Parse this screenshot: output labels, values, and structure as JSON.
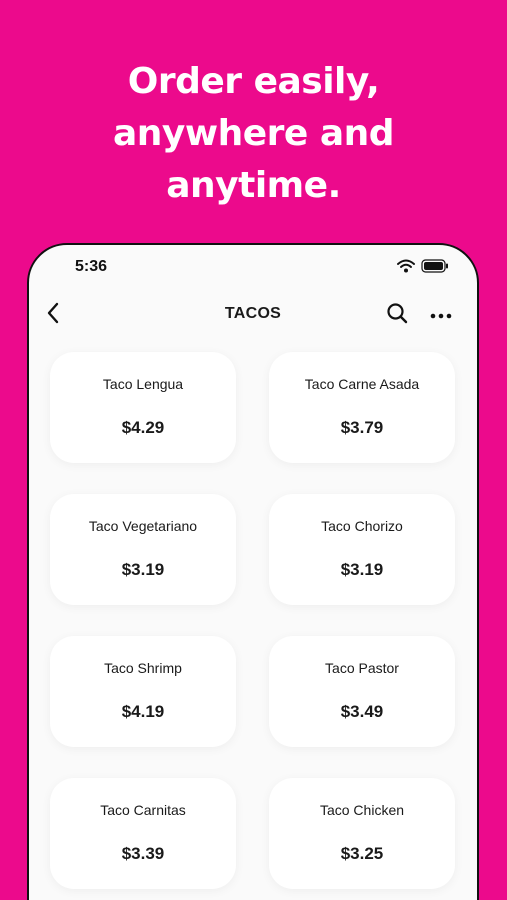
{
  "promo": {
    "line1": "Order easily,",
    "line2": "anywhere and",
    "line3": "anytime."
  },
  "status_bar": {
    "time": "5:36",
    "icons": [
      "wifi-icon",
      "battery-icon"
    ]
  },
  "header": {
    "title": "TACOS",
    "icons": [
      "back-chevron-icon",
      "search-icon",
      "more-icon"
    ]
  },
  "menu_items": [
    {
      "name": "Taco Lengua",
      "price": "$4.29"
    },
    {
      "name": "Taco Carne Asada",
      "price": "$3.79"
    },
    {
      "name": "Taco Vegetariano",
      "price": "$3.19"
    },
    {
      "name": "Taco Chorizo",
      "price": "$3.19"
    },
    {
      "name": "Taco Shrimp",
      "price": "$4.19"
    },
    {
      "name": "Taco Pastor",
      "price": "$3.49"
    },
    {
      "name": "Taco Carnitas",
      "price": "$3.39"
    },
    {
      "name": "Taco Chicken",
      "price": "$3.25"
    }
  ],
  "colors": {
    "brand_background": "#ec0a8c",
    "screen_background": "#fafafa",
    "card_background": "#ffffff",
    "text": "#1a1a1a"
  }
}
